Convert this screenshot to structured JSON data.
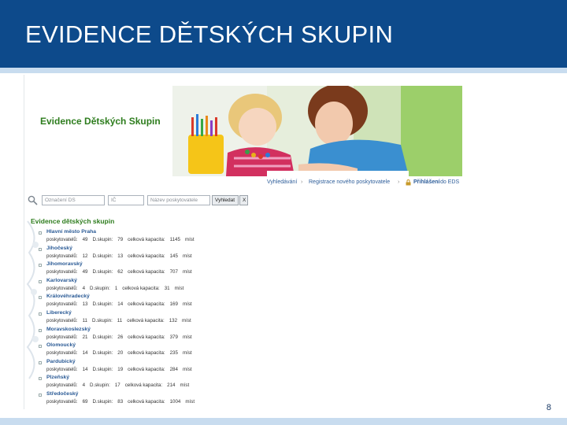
{
  "slide": {
    "title": "EVIDENCE DĚTSKÝCH SKUPIN",
    "page_number": "8",
    "colors": {
      "header": "#0d4a8b",
      "stripe": "#c8dcef",
      "green": "#2e7d1e",
      "link": "#2a5a95"
    }
  },
  "site": {
    "banner_title": "Evidence Dětských Skupin",
    "nav": {
      "search": "Vyhledávání",
      "register": "Registrace nového poskytovatele",
      "login": "Přihlášení",
      "login_icon": "lock-icon",
      "suffix": "do EDS"
    },
    "search": {
      "field1_placeholder": "Označení DS",
      "field2_placeholder": "IČ",
      "field3_placeholder": "Název poskytovatele",
      "search_button": "Vyhledat",
      "clear_button": "X"
    },
    "section_title": "Evidence dětských skupin",
    "stats_labels": {
      "providers": "poskytovatelů:",
      "groups": "D.skupin:",
      "capacity": "celková kapacita:",
      "unit": "míst"
    },
    "regions": [
      {
        "name": "Hlavní město Praha",
        "providers": "49",
        "groups": "79",
        "capacity": "1145"
      },
      {
        "name": "Jihočeský",
        "providers": "12",
        "groups": "13",
        "capacity": "145"
      },
      {
        "name": "Jihomoravský",
        "providers": "49",
        "groups": "62",
        "capacity": "707"
      },
      {
        "name": "Karlovarský",
        "providers": "4",
        "groups": "1",
        "capacity": "31"
      },
      {
        "name": "Královéhradecký",
        "providers": "13",
        "groups": "14",
        "capacity": "169"
      },
      {
        "name": "Liberecký",
        "providers": "11",
        "groups": "11",
        "capacity": "132"
      },
      {
        "name": "Moravskoslezský",
        "providers": "21",
        "groups": "26",
        "capacity": "379"
      },
      {
        "name": "Olomoucký",
        "providers": "14",
        "groups": "20",
        "capacity": "235"
      },
      {
        "name": "Pardubický",
        "providers": "14",
        "groups": "19",
        "capacity": "284"
      },
      {
        "name": "Plzeňský",
        "providers": "4",
        "groups": "17",
        "capacity": "214"
      },
      {
        "name": "Středočeský",
        "providers": "69",
        "groups": "83",
        "capacity": "1004"
      }
    ]
  }
}
